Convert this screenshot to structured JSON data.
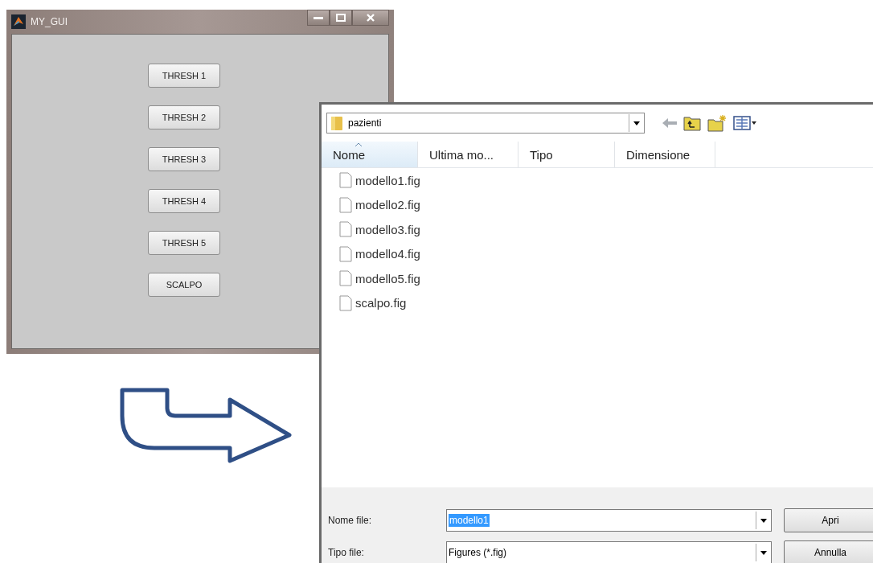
{
  "gui_window": {
    "title": "MY_GUI",
    "buttons": [
      "THRESH 1",
      "THRESH 2",
      "THRESH 3",
      "THRESH 4",
      "THRESH 5",
      "SCALPO"
    ]
  },
  "file_dialog": {
    "folder": "pazienti",
    "columns": [
      {
        "label": "Nome",
        "sorted": true
      },
      {
        "label": "Ultima mo...",
        "sorted": false
      },
      {
        "label": "Tipo",
        "sorted": false
      },
      {
        "label": "Dimensione",
        "sorted": false
      }
    ],
    "files": [
      "modello1.fig",
      "modello2.fig",
      "modello3.fig",
      "modello4.fig",
      "modello5.fig",
      "scalpo.fig"
    ],
    "file_name": {
      "label": "Nome file:",
      "value": "modello1"
    },
    "file_type": {
      "label": "Tipo file:",
      "value": "Figures (*.fig)"
    },
    "buttons": [
      "Apri",
      "Annulla"
    ]
  }
}
